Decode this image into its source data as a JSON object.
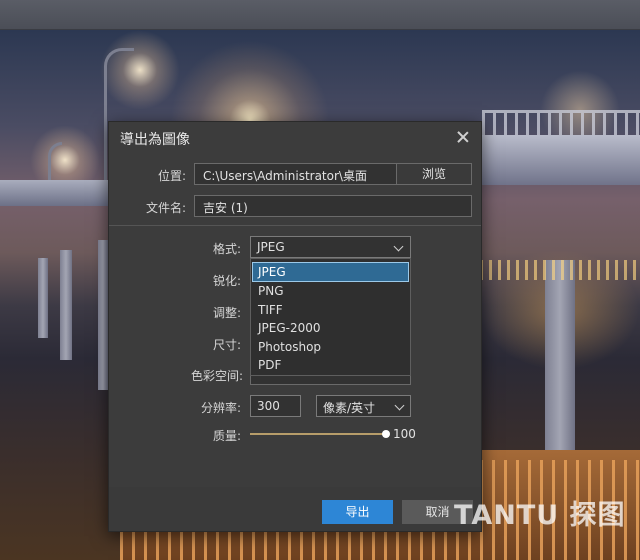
{
  "dialog": {
    "title": "導出為圖像",
    "location_label": "位置:",
    "location_value": "C:\\Users\\Administrator\\桌面",
    "browse_label": "浏览",
    "filename_label": "文件名:",
    "filename_value": "吉安 (1)",
    "format_label": "格式:",
    "format_value": "JPEG",
    "format_options": [
      "JPEG",
      "PNG",
      "TIFF",
      "JPEG-2000",
      "Photoshop",
      "PDF"
    ],
    "sharpen_label": "锐化:",
    "adjust_label": "调整:",
    "size_label": "尺寸:",
    "colorspace_label": "色彩空间:",
    "resolution_label": "分辨率:",
    "resolution_value": "300",
    "resolution_unit": "像素/英寸",
    "quality_label": "质量:",
    "quality_value": "100",
    "export_button": "导出",
    "cancel_button": "取消"
  },
  "watermark": "TANTU 探图"
}
